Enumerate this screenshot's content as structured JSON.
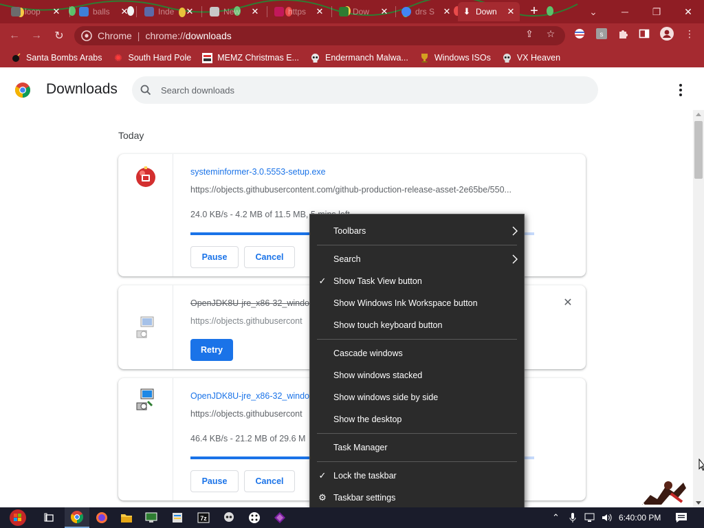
{
  "tabs": [
    {
      "title": "loop",
      "color": "#6c6c6c"
    },
    {
      "title": "balls",
      "color": "#3f7fd8"
    },
    {
      "title": "Inde",
      "color": "#5b6aa8"
    },
    {
      "title": "New",
      "color": "#c8c8c8"
    },
    {
      "title": "https",
      "color": "#c2185b"
    },
    {
      "title": "Dow",
      "color": "#2e7d32"
    },
    {
      "title": "drs S",
      "color": "#4285f4"
    },
    {
      "title": "Down",
      "color": "#ffffff"
    }
  ],
  "toolbar": {
    "origin": "Chrome",
    "url_scheme": "chrome://",
    "url_host": "downloads"
  },
  "bookmarks": [
    {
      "label": "Santa Bombs Arabs",
      "icon": "bomb-icon"
    },
    {
      "label": "South Hard Pole",
      "icon": "snowflake-icon"
    },
    {
      "label": "MEMZ Christmas E...",
      "icon": "memz-icon"
    },
    {
      "label": "Endermanch Malwa...",
      "icon": "skull-icon"
    },
    {
      "label": "Windows ISOs",
      "icon": "trophy-icon"
    },
    {
      "label": "VX Heaven",
      "icon": "skull-icon"
    }
  ],
  "downloads": {
    "title": "Downloads",
    "search_placeholder": "Search downloads",
    "day": "Today",
    "items": [
      {
        "name": "systeminformer-3.0.5553-setup.exe",
        "url": "https://objects.githubusercontent.com/github-production-release-asset-2e65be/550...",
        "status": "24.0 KB/s - 4.2 MB of 11.5 MB, 5 mins left",
        "progress": 0.37,
        "buttons": [
          "Pause",
          "Cancel"
        ]
      },
      {
        "name": "OpenJDK8U-jre_x86-32_windo",
        "url": "https://objects.githubusercont",
        "retry": "Retry",
        "cancelled": true
      },
      {
        "name": "OpenJDK8U-jre_x86-32_windo",
        "url": "https://objects.githubusercont",
        "status": "46.4 KB/s - 21.2 MB of 29.6 M",
        "progress": 0.72,
        "buttons": [
          "Pause",
          "Cancel"
        ]
      }
    ]
  },
  "context_menu": {
    "items": [
      {
        "label": "Toolbars",
        "submenu": true
      },
      {
        "label": "Search",
        "submenu": true
      },
      {
        "label": "Show Task View button",
        "checked": true
      },
      {
        "label": "Show Windows Ink Workspace button"
      },
      {
        "label": "Show touch keyboard button"
      },
      {
        "label": "Cascade windows"
      },
      {
        "label": "Show windows stacked"
      },
      {
        "label": "Show windows side by side"
      },
      {
        "label": "Show the desktop"
      },
      {
        "label": "Task Manager"
      },
      {
        "label": "Lock the taskbar",
        "checked": true
      },
      {
        "label": "Taskbar settings",
        "icon": "gear-icon"
      }
    ]
  },
  "taskbar": {
    "clock": "6:40:00 PM"
  },
  "colors": {
    "theme": "#a52a30",
    "tabstrip": "#8f1d24",
    "link": "#1a73e8",
    "menu_bg": "#2b2b2b",
    "taskbar": "#1a1c2b"
  }
}
